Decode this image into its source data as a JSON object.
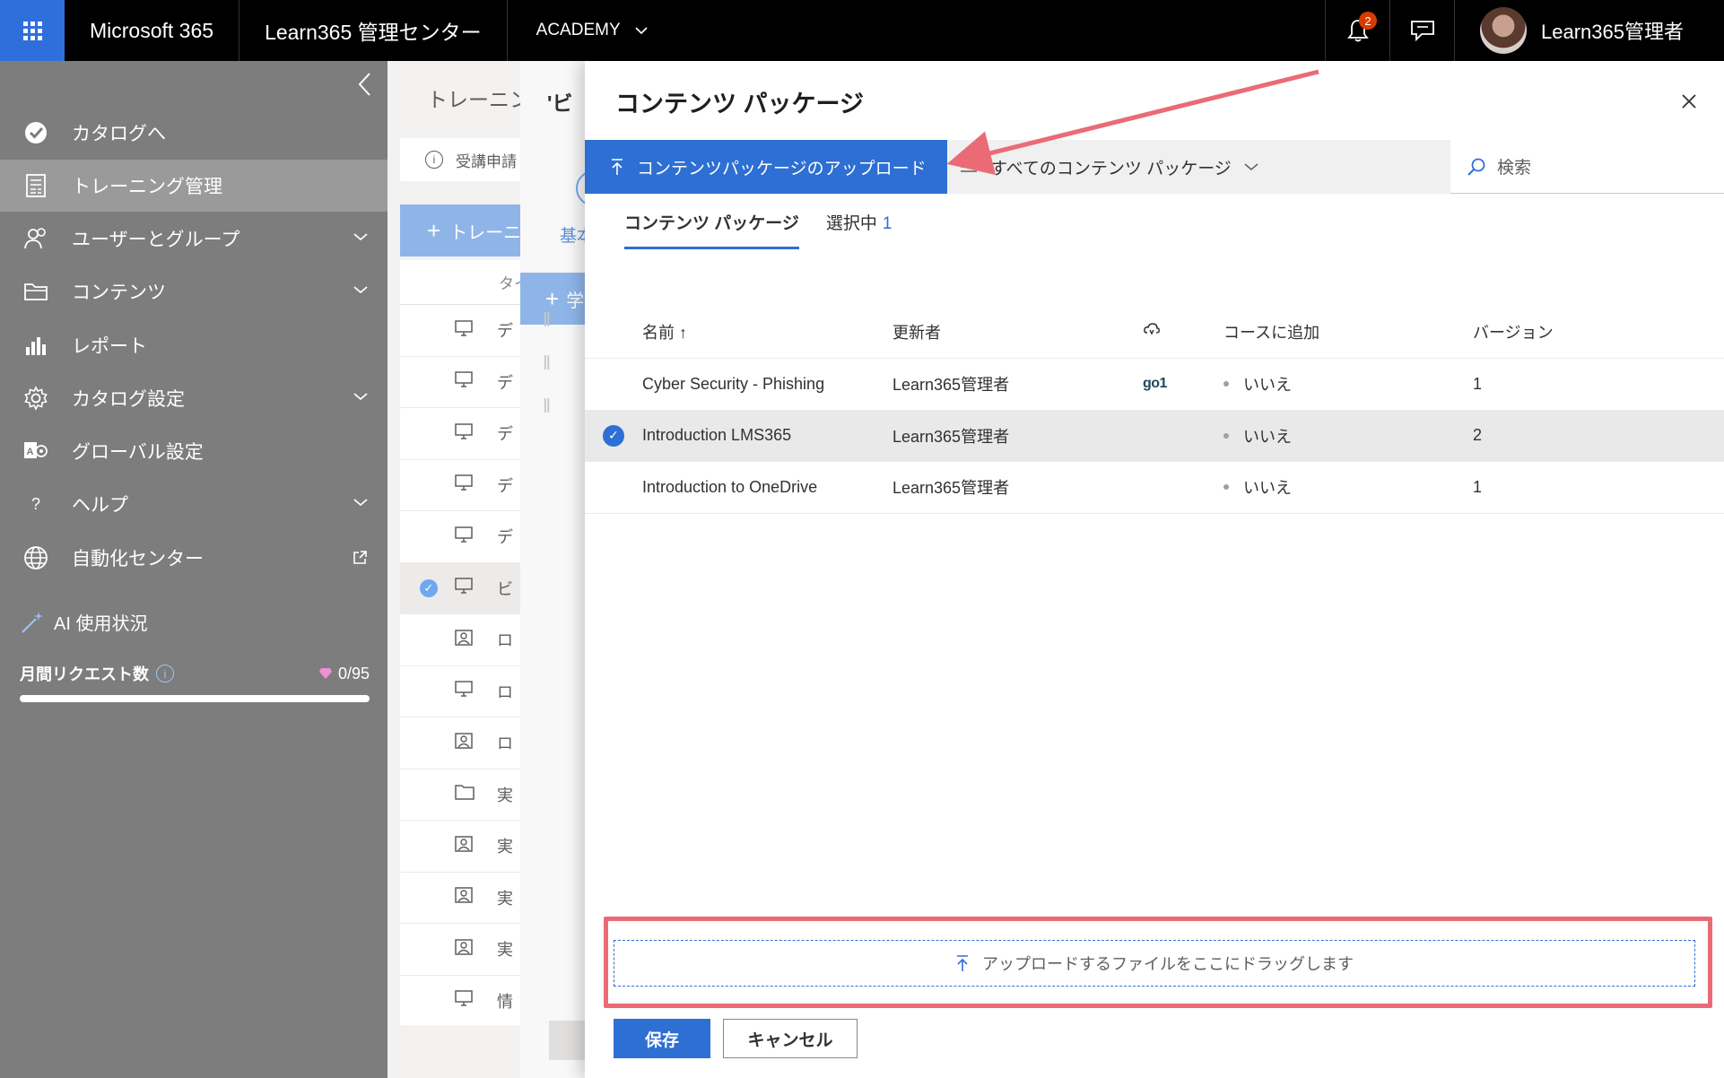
{
  "topbar": {
    "app_name": "Microsoft 365",
    "center_name": "Learn365 管理センター",
    "tenant": "ACADEMY",
    "notification_count": "2",
    "user_name": "Learn365管理者"
  },
  "sidebar": {
    "items": [
      {
        "label": "カタログへ",
        "icon": "catalog-check-icon"
      },
      {
        "label": "トレーニング管理",
        "icon": "document-list-icon",
        "active": true
      },
      {
        "label": "ユーザーとグループ",
        "icon": "users-icon",
        "expandable": true
      },
      {
        "label": "コンテンツ",
        "icon": "folder-icon",
        "expandable": true
      },
      {
        "label": "レポート",
        "icon": "bar-chart-icon"
      },
      {
        "label": "カタログ設定",
        "icon": "gear-icon",
        "expandable": true
      },
      {
        "label": "グローバル設定",
        "icon": "global-settings-icon"
      },
      {
        "label": "ヘルプ",
        "icon": "help-icon",
        "expandable": true
      },
      {
        "label": "自動化センター",
        "icon": "globe-icon",
        "external": true
      }
    ],
    "ai": {
      "title": "AI 使用状況",
      "request_label": "月間リクエスト数",
      "request_value": "0/95",
      "usage_fraction": 0
    }
  },
  "background_page": {
    "title": "トレーニング",
    "info_text": "受講申請",
    "new_button": "トレーニ",
    "column_header": "タイ",
    "rows": [
      {
        "icon": "monitor-icon",
        "text": "デ"
      },
      {
        "icon": "monitor-icon",
        "text": "デ"
      },
      {
        "icon": "monitor-icon",
        "text": "デ"
      },
      {
        "icon": "monitor-icon",
        "text": "デ"
      },
      {
        "icon": "monitor-icon",
        "text": "デ"
      },
      {
        "icon": "monitor-icon",
        "text": "ビ",
        "selected": true
      },
      {
        "icon": "person-board-icon",
        "text": "ロ"
      },
      {
        "icon": "monitor-icon",
        "text": "ロ"
      },
      {
        "icon": "person-board-icon",
        "text": "ロ"
      },
      {
        "icon": "folder-icon",
        "text": "実"
      },
      {
        "icon": "person-board-icon",
        "text": "実"
      },
      {
        "icon": "person-board-icon",
        "text": "実"
      },
      {
        "icon": "person-board-icon",
        "text": "実"
      },
      {
        "icon": "monitor-icon",
        "text": "情"
      }
    ]
  },
  "second_panel": {
    "title": "'ビ",
    "tab": "基本",
    "add_button": "学"
  },
  "dialog": {
    "title": "コンテンツ パッケージ",
    "upload_button": "コンテンツパッケージのアップロード",
    "filter_label": "すべてのコンテンツ パッケージ",
    "search_placeholder": "検索",
    "tabs": [
      {
        "label": "コンテンツ パッケージ",
        "active": true
      },
      {
        "label": "選択中",
        "count": "1"
      }
    ],
    "columns": {
      "name": "名前 ↑",
      "updated_by": "更新者",
      "added_to_course": "コースに追加",
      "version": "バージョン"
    },
    "rows": [
      {
        "name": "Cyber Security - Phishing",
        "updated_by": "Learn365管理者",
        "source": "go1",
        "added": "いいえ",
        "version": "1",
        "selected": false
      },
      {
        "name": "Introduction LMS365",
        "updated_by": "Learn365管理者",
        "source": "",
        "added": "いいえ",
        "version": "2",
        "selected": true
      },
      {
        "name": "Introduction to OneDrive",
        "updated_by": "Learn365管理者",
        "source": "",
        "added": "いいえ",
        "version": "1",
        "selected": false
      }
    ],
    "dropzone_text": "アップロードするファイルをここにドラッグします",
    "save_button": "保存",
    "cancel_button": "キャンセル"
  },
  "colors": {
    "brand_blue": "#2e6fd3",
    "annotation_red": "#ea6b76",
    "sidebar_bg": "#7d7d7d"
  }
}
